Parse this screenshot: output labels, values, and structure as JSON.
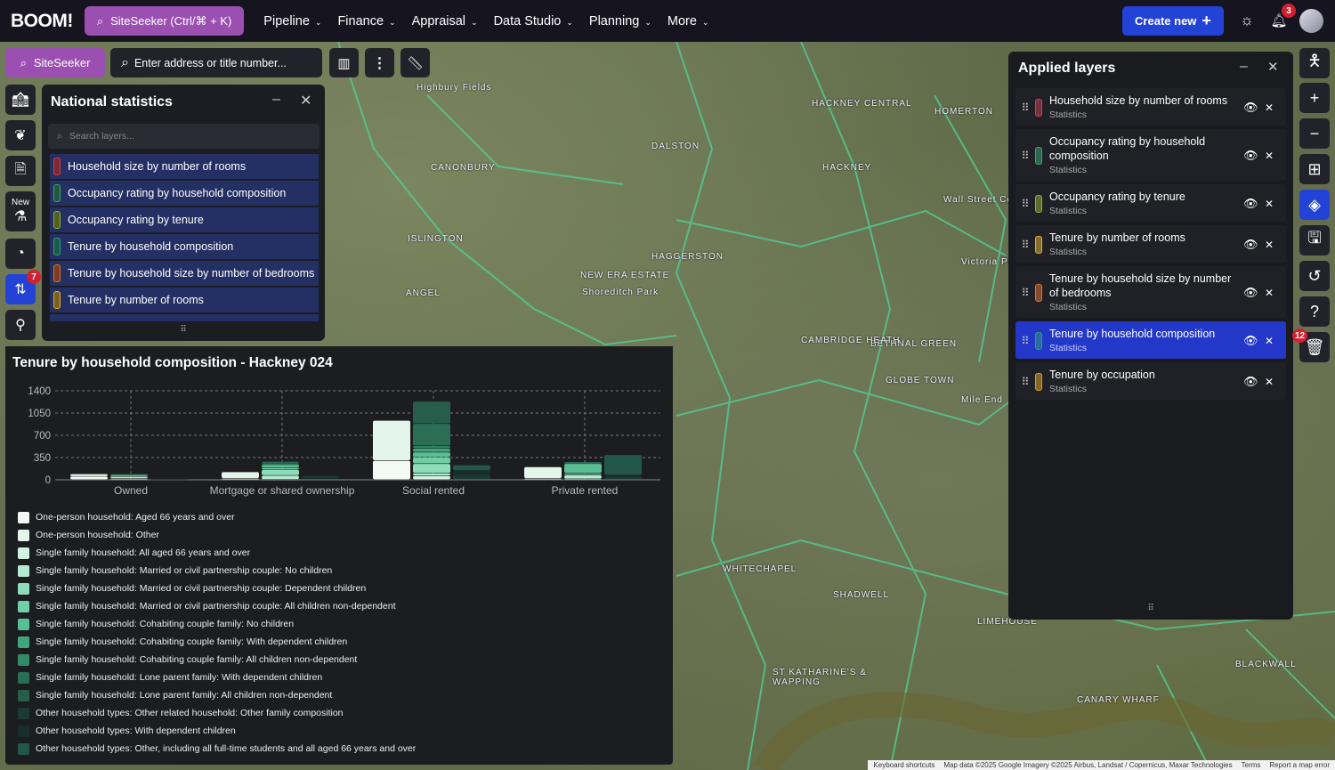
{
  "topbar": {
    "logo": "BOOM!",
    "siteseeker": "SiteSeeker (Ctrl/⌘ + K)",
    "nav": [
      "Pipeline",
      "Finance",
      "Appraisal",
      "Data Studio",
      "Planning",
      "More"
    ],
    "create_new": "Create new",
    "notifications_count": "3"
  },
  "toolbar": {
    "siteseeker": "SiteSeeker",
    "search_placeholder": "Enter address or title number..."
  },
  "sidebar": {
    "new_label": "New",
    "badge": "7"
  },
  "national_stats": {
    "title": "National statistics",
    "search_placeholder": "Search layers...",
    "items": [
      {
        "label": "Household size by number of rooms",
        "color": "#c9404a"
      },
      {
        "label": "Occupancy rating by household composition",
        "color": "#3aa56a"
      },
      {
        "label": "Occupancy rating by tenure",
        "color": "#8fb030"
      },
      {
        "label": "Tenure by household composition",
        "color": "#2f9b7b"
      },
      {
        "label": "Tenure by household size by number of bedrooms",
        "color": "#e0702c"
      },
      {
        "label": "Tenure by number of rooms",
        "color": "#e0b030"
      }
    ]
  },
  "applied_layers": {
    "title": "Applied layers",
    "items": [
      {
        "label": "Household size by number of rooms",
        "sub": "Statistics",
        "color": "#c9404a"
      },
      {
        "label": "Occupancy rating by household composition",
        "sub": "Statistics",
        "color": "#3aa56a"
      },
      {
        "label": "Occupancy rating by tenure",
        "sub": "Statistics",
        "color": "#8fb030"
      },
      {
        "label": "Tenure by number of rooms",
        "sub": "Statistics",
        "color": "#e0b030"
      },
      {
        "label": "Tenure by household size by number of bedrooms",
        "sub": "Statistics",
        "color": "#e0702c"
      },
      {
        "label": "Tenure by household composition",
        "sub": "Statistics",
        "color": "#2f9b7b",
        "selected": true
      },
      {
        "label": "Tenure by occupation",
        "sub": "Statistics",
        "color": "#e0a020"
      }
    ]
  },
  "right_tools": {
    "trash_badge": "12"
  },
  "chart_data": {
    "type": "bar",
    "stacked": true,
    "title": "Tenure by household composition - Hackney 024",
    "categories": [
      "Owned",
      "Mortgage or shared ownership",
      "Social rented",
      "Private rented"
    ],
    "ylim": [
      0,
      1400
    ],
    "yticks": [
      "0",
      "350",
      "700",
      "1050",
      "1400"
    ],
    "grid": true,
    "legend": "bottom",
    "series": [
      {
        "name": "One-person household: Aged 66 years and over",
        "stack": 0,
        "color": "#f4fbf7",
        "values": [
          50,
          20,
          300,
          20
        ]
      },
      {
        "name": "One-person household: Other",
        "stack": 0,
        "color": "#e4f6ec",
        "values": [
          40,
          100,
          630,
          180
        ]
      },
      {
        "name": "Single family household: All aged 66 years and over",
        "stack": 1,
        "color": "#d2f2e2",
        "values": [
          20,
          5,
          60,
          10
        ]
      },
      {
        "name": "Single family household: Married or civil partnership couple: No children",
        "stack": 1,
        "color": "#b5ead2",
        "values": [
          25,
          60,
          40,
          60
        ]
      },
      {
        "name": "Single family household: Married or civil partnership couple: Dependent children",
        "stack": 1,
        "color": "#8fdcbb",
        "values": [
          15,
          90,
          150,
          20
        ]
      },
      {
        "name": "Single family household: Married or civil partnership couple: All children non-dependent",
        "stack": 1,
        "color": "#70cfa4",
        "values": [
          10,
          30,
          100,
          10
        ]
      },
      {
        "name": "Single family household: Cohabiting couple family: No children",
        "stack": 1,
        "color": "#58bf92",
        "values": [
          5,
          50,
          80,
          150
        ]
      },
      {
        "name": "Single family household: Cohabiting couple family: With dependent children",
        "stack": 1,
        "color": "#40a57c",
        "values": [
          5,
          20,
          60,
          20
        ]
      },
      {
        "name": "Single family household: Cohabiting couple family: All children non-dependent",
        "stack": 1,
        "color": "#318a68",
        "values": [
          0,
          5,
          40,
          0
        ]
      },
      {
        "name": "Single family household: Lone parent family: With dependent children",
        "stack": 1,
        "color": "#2a6e56",
        "values": [
          5,
          20,
          350,
          10
        ]
      },
      {
        "name": "Single family household: Lone parent family: All children non-dependent",
        "stack": 1,
        "color": "#265e4b",
        "values": [
          5,
          10,
          350,
          0
        ]
      },
      {
        "name": "Other household types: Other related household: Other family composition",
        "stack": 2,
        "color": "#1a3a33",
        "values": [
          5,
          20,
          80,
          50
        ]
      },
      {
        "name": "Other household types: With dependent children",
        "stack": 2,
        "color": "#172f2c",
        "values": [
          0,
          10,
          60,
          20
        ]
      },
      {
        "name": "Other household types: Other, including all full-time students and all aged 66 years and over",
        "stack": 2,
        "color": "#22564a",
        "values": [
          5,
          20,
          90,
          320
        ]
      }
    ]
  },
  "map_labels": [
    "Highbury Fields",
    "DALSTON",
    "HACKNEY",
    "CANONBURY",
    "ISLINGTON",
    "ANGEL",
    "NEW ERA ESTATE",
    "HAGGERSTON",
    "BETHNAL GREEN",
    "CAMBRIDGE HEATH",
    "GLOBE TOWN",
    "WHITECHAPEL",
    "SHADWELL",
    "LIMEHOUSE",
    "ST KATHARINE'S & WAPPING",
    "CANARY WHARF",
    "BLACKWALL",
    "HACKNEY CENTRAL",
    "HOMERTON",
    "Mile End",
    "Victoria Park",
    "Shoreditch Park",
    "Wall Street Common"
  ],
  "footer": [
    "Keyboard shortcuts",
    "Map data ©2025 Google Imagery ©2025 Airbus, Landsat / Copernicus, Maxar Technologies",
    "Terms",
    "Report a map error"
  ]
}
